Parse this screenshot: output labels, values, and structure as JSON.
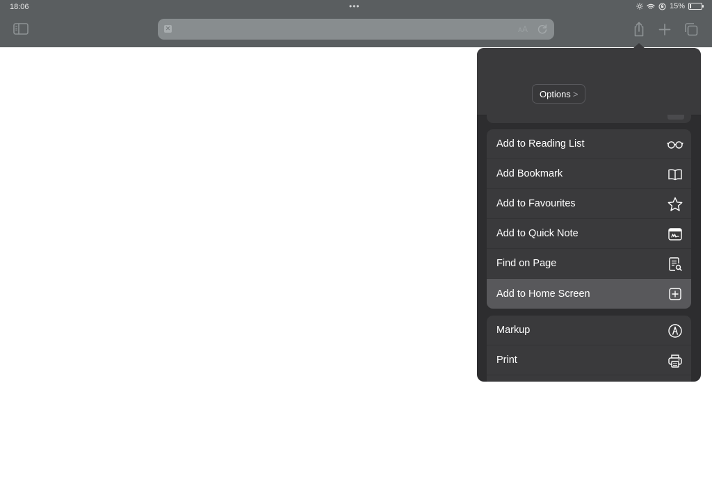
{
  "status": {
    "time": "18:06",
    "battery": "15%",
    "battery_level": 0.15
  },
  "menu": {
    "options_label": "Options",
    "options_chevron": ">",
    "group1": [
      {
        "label": "Add to Reading List",
        "icon": "glasses-icon"
      },
      {
        "label": "Add Bookmark",
        "icon": "book-icon"
      },
      {
        "label": "Add to Favourites",
        "icon": "star-icon"
      },
      {
        "label": "Add to Quick Note",
        "icon": "quick-note-icon"
      },
      {
        "label": "Find on Page",
        "icon": "find-on-page-icon"
      },
      {
        "label": "Add to Home Screen",
        "icon": "plus-square-icon",
        "highlighted": true
      }
    ],
    "group2": [
      {
        "label": "Markup",
        "icon": "markup-icon"
      },
      {
        "label": "Print",
        "icon": "printer-icon"
      }
    ]
  },
  "colors": {
    "topbar": "#5a5e60",
    "popover": "#2d2d2f",
    "group": "#3a3a3c",
    "highlight": "#58585b"
  }
}
